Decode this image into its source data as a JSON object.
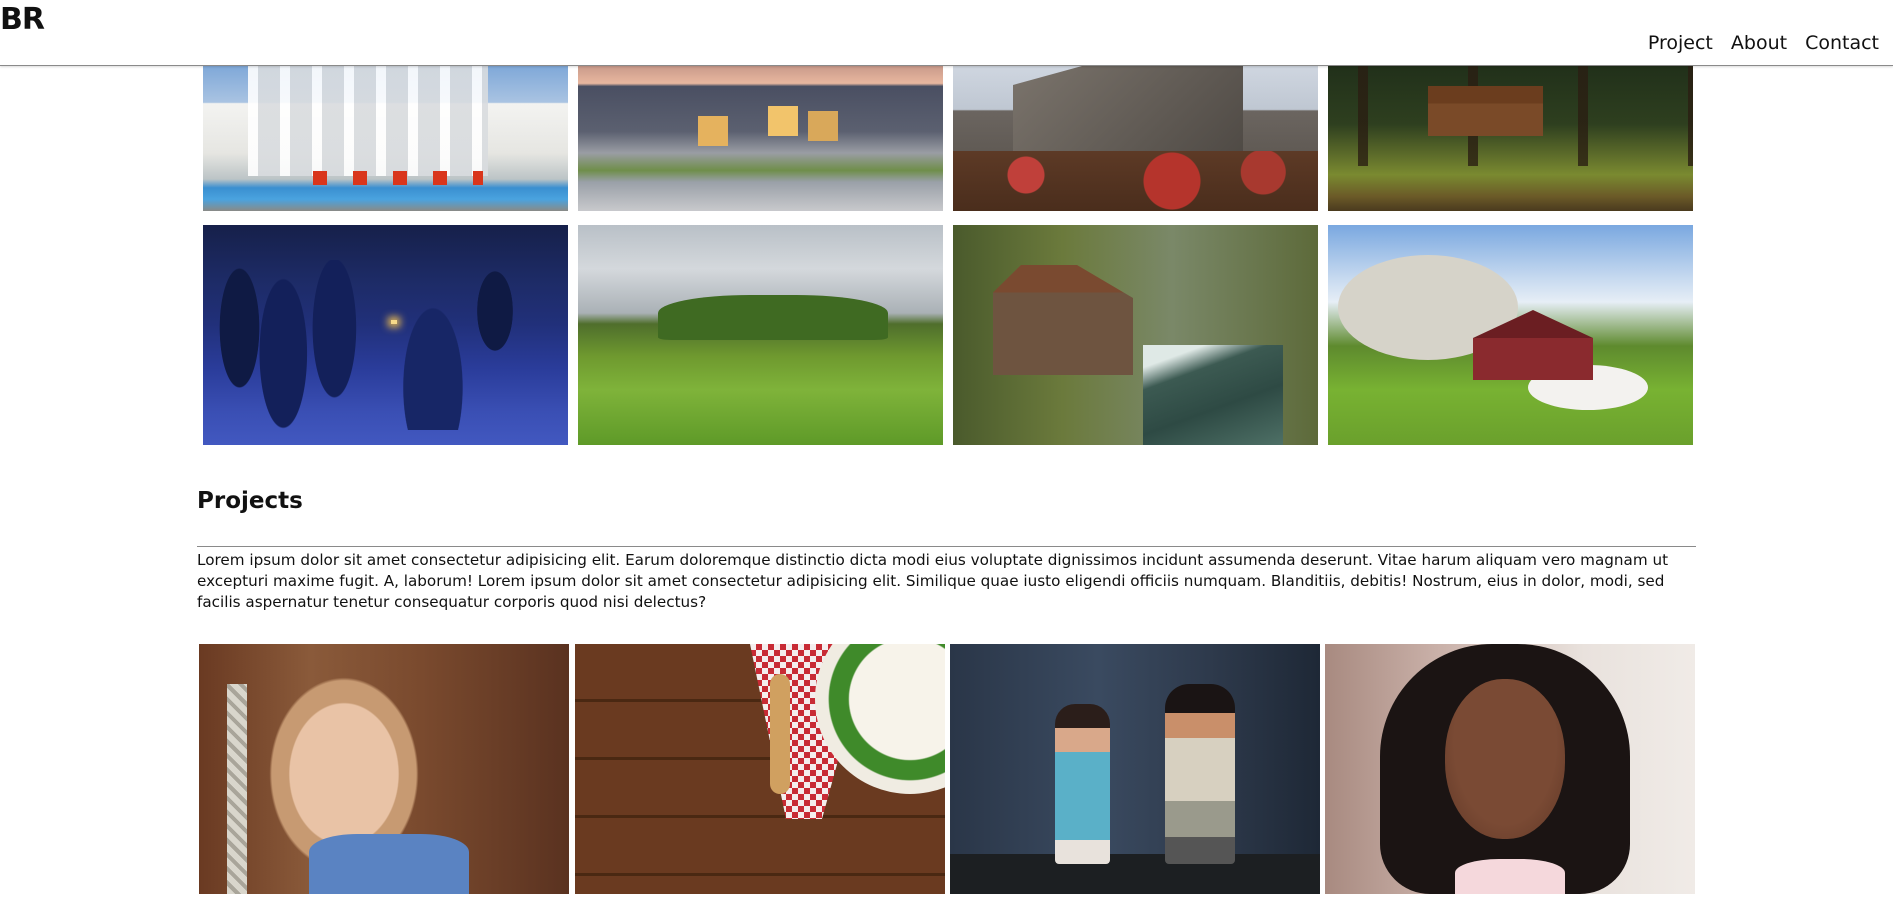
{
  "header": {
    "logo": "BR",
    "nav": [
      "Project",
      "About",
      "Contact"
    ]
  },
  "section": {
    "title": "Projects",
    "text": "Lorem ipsum dolor sit amet consectetur adipisicing elit. Earum doloremque distinctio dicta modi eius voluptate dignissimos incidunt assumenda deserunt. Vitae harum aliquam vero magnam ut excepturi maxime fugit. A, laborum! Lorem ipsum dolor sit amet consectetur adipisicing elit. Similique quae iusto eligendi officiis numquam. Blanditiis, debitis! Nostrum, eius in dolor, modi, sed facilis aspernatur tenetur consequatur corporis quod nisi delectus?"
  },
  "gallery_houses": [
    "white-villa-with-pool",
    "suburban-house-at-dusk",
    "stone-mansion-with-flowers",
    "log-cabin-in-forest",
    "snowy-cabin-at-night",
    "turf-roof-house",
    "watermill-by-river",
    "red-cottage-in-meadow"
  ],
  "gallery_people": [
    "girl-with-rope",
    "salad-on-wooden-table",
    "two-children",
    "woman-portrait"
  ]
}
